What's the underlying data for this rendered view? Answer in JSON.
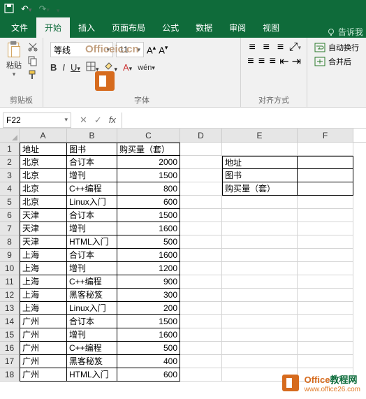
{
  "titlebar": {
    "save": "save-icon",
    "undo": "undo-icon",
    "redo": "redo-icon"
  },
  "tabs": {
    "file": "文件",
    "home": "开始",
    "insert": "插入",
    "layout": "页面布局",
    "formula": "公式",
    "data": "数据",
    "review": "审阅",
    "view": "视图",
    "tell": "告诉我"
  },
  "ribbon": {
    "clipboard": {
      "label": "剪贴板",
      "paste": "粘贴"
    },
    "font": {
      "label": "字体",
      "name": "等线",
      "size": "11",
      "watermark": "Officeic.cn"
    },
    "align": {
      "label": "对齐方式",
      "autowrap": "自动换行",
      "merge": "合并后"
    }
  },
  "namebox": "F22",
  "columns": [
    "A",
    "B",
    "C",
    "D",
    "E",
    "F"
  ],
  "rows": [
    {
      "n": "1",
      "A": "地址",
      "B": "图书",
      "C": "购买量（套）",
      "E": ""
    },
    {
      "n": "2",
      "A": "北京",
      "B": "合订本",
      "C": "2000",
      "E": "地址"
    },
    {
      "n": "3",
      "A": "北京",
      "B": "增刊",
      "C": "1500",
      "E": "图书"
    },
    {
      "n": "4",
      "A": "北京",
      "B": "C++编程",
      "C": "800",
      "E": "购买量（套）"
    },
    {
      "n": "5",
      "A": "北京",
      "B": "Linux入门",
      "C": "600",
      "E": ""
    },
    {
      "n": "6",
      "A": "天津",
      "B": "合订本",
      "C": "1500",
      "E": ""
    },
    {
      "n": "7",
      "A": "天津",
      "B": "增刊",
      "C": "1600",
      "E": ""
    },
    {
      "n": "8",
      "A": "天津",
      "B": "HTML入门",
      "C": "500",
      "E": ""
    },
    {
      "n": "9",
      "A": "上海",
      "B": "合订本",
      "C": "1600",
      "E": ""
    },
    {
      "n": "10",
      "A": "上海",
      "B": "增刊",
      "C": "1200",
      "E": ""
    },
    {
      "n": "11",
      "A": "上海",
      "B": "C++编程",
      "C": "900",
      "E": ""
    },
    {
      "n": "12",
      "A": "上海",
      "B": "黑客秘笈",
      "C": "300",
      "E": ""
    },
    {
      "n": "13",
      "A": "上海",
      "B": "Linux入门",
      "C": "200",
      "E": ""
    },
    {
      "n": "14",
      "A": "广州",
      "B": "合订本",
      "C": "1500",
      "E": ""
    },
    {
      "n": "15",
      "A": "广州",
      "B": "增刊",
      "C": "1600",
      "E": ""
    },
    {
      "n": "16",
      "A": "广州",
      "B": "C++编程",
      "C": "500",
      "E": ""
    },
    {
      "n": "17",
      "A": "广州",
      "B": "黑客秘笈",
      "C": "400",
      "E": ""
    },
    {
      "n": "18",
      "A": "广州",
      "B": "HTML入门",
      "C": "600",
      "E": ""
    }
  ],
  "watermark2": {
    "brand1": "Office",
    "brand2": "教程网",
    "url": "www.office26.com"
  }
}
